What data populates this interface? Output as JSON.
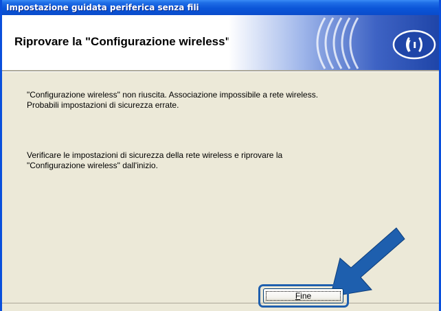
{
  "window": {
    "title": "Impostazione guidata periferica senza fili"
  },
  "header": {
    "title": "Riprovare la \"Configurazione wireless\""
  },
  "body": {
    "paragraph_1": [
      "\"Configurazione wireless\" non riuscita. Associazione impossibile a rete wireless.",
      "Probabili impostazioni di sicurezza errate."
    ],
    "paragraph_2": [
      "Verificare le impostazioni di sicurezza della rete wireless e riprovare la",
      "\"Configurazione wireless\" dall'inizio."
    ]
  },
  "buttons": {
    "finish_mnemonic": "F",
    "finish_rest": "ine"
  },
  "colors": {
    "titlebar_blue": "#0b55d8",
    "dialog_bg": "#ece9d8",
    "arrow_blue": "#1e5fae",
    "banner_blue": "#2f55b7"
  },
  "icons": {
    "banner": "wireless-signal-icon",
    "pointer": "arrow-pointer-icon"
  }
}
